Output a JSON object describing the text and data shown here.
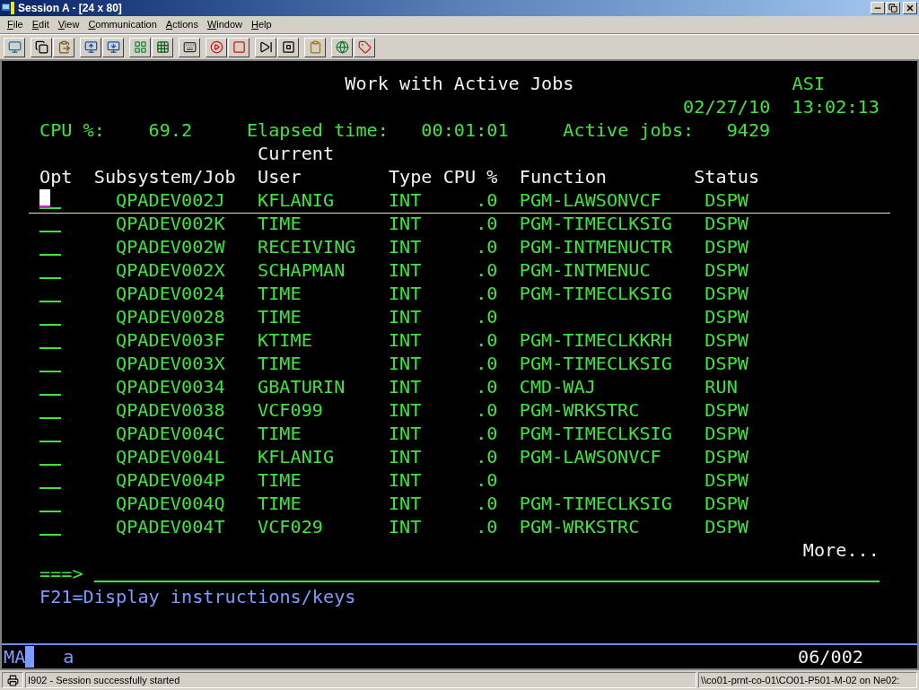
{
  "window": {
    "title": "Session A - [24 x 80]"
  },
  "menu": [
    "File",
    "Edit",
    "View",
    "Communication",
    "Actions",
    "Window",
    "Help"
  ],
  "screen": {
    "title": "Work with Active Jobs",
    "system": "ASI",
    "date": "02/27/10",
    "time": "13:02:13",
    "summary": [
      {
        "label": "CPU %:",
        "value": "69.2"
      },
      {
        "label": "Elapsed time:",
        "value": "00:01:01"
      },
      {
        "label": "Active jobs:",
        "value": "9429"
      }
    ],
    "columns": [
      {
        "label": "Opt"
      },
      {
        "label": "Subsystem/Job"
      },
      {
        "top": "Current",
        "label": "User"
      },
      {
        "label": "Type"
      },
      {
        "label": "CPU %"
      },
      {
        "label": "Function"
      },
      {
        "label": "Status"
      }
    ],
    "rows": [
      {
        "cursor": true,
        "job": "QPADEV002J",
        "user": "KFLANIG",
        "type": "INT",
        "cpu": ".0",
        "function": "PGM-LAWSONVCF",
        "status": "DSPW"
      },
      {
        "cursor": false,
        "job": "QPADEV002K",
        "user": "TIME",
        "type": "INT",
        "cpu": ".0",
        "function": "PGM-TIMECLKSIG",
        "status": "DSPW"
      },
      {
        "cursor": false,
        "job": "QPADEV002W",
        "user": "RECEIVING",
        "type": "INT",
        "cpu": ".0",
        "function": "PGM-INTMENUCTR",
        "status": "DSPW"
      },
      {
        "cursor": false,
        "job": "QPADEV002X",
        "user": "SCHAPMAN",
        "type": "INT",
        "cpu": ".0",
        "function": "PGM-INTMENUC",
        "status": "DSPW"
      },
      {
        "cursor": false,
        "job": "QPADEV0024",
        "user": "TIME",
        "type": "INT",
        "cpu": ".0",
        "function": "PGM-TIMECLKSIG",
        "status": "DSPW"
      },
      {
        "cursor": false,
        "job": "QPADEV0028",
        "user": "TIME",
        "type": "INT",
        "cpu": ".0",
        "status": "DSPW"
      },
      {
        "cursor": false,
        "job": "QPADEV003F",
        "user": "KTIME",
        "type": "INT",
        "cpu": ".0",
        "function": "PGM-TIMECLKKRH",
        "status": "DSPW"
      },
      {
        "cursor": false,
        "job": "QPADEV003X",
        "user": "TIME",
        "type": "INT",
        "cpu": ".0",
        "function": "PGM-TIMECLKSIG",
        "status": "DSPW"
      },
      {
        "cursor": false,
        "job": "QPADEV0034",
        "user": "GBATURIN",
        "type": "INT",
        "cpu": ".0",
        "function": "CMD-WAJ",
        "status": "RUN"
      },
      {
        "cursor": false,
        "job": "QPADEV0038",
        "user": "VCF099",
        "type": "INT",
        "cpu": ".0",
        "function": "PGM-WRKSTRC",
        "status": "DSPW"
      },
      {
        "cursor": false,
        "job": "QPADEV004C",
        "user": "TIME",
        "type": "INT",
        "cpu": ".0",
        "function": "PGM-TIMECLKSIG",
        "status": "DSPW"
      },
      {
        "cursor": false,
        "job": "QPADEV004L",
        "user": "KFLANIG",
        "type": "INT",
        "cpu": ".0",
        "function": "PGM-LAWSONVCF",
        "status": "DSPW"
      },
      {
        "cursor": false,
        "job": "QPADEV004P",
        "user": "TIME",
        "type": "INT",
        "cpu": ".0",
        "status": "DSPW"
      },
      {
        "cursor": false,
        "job": "QPADEV004Q",
        "user": "TIME",
        "type": "INT",
        "cpu": ".0",
        "function": "PGM-TIMECLKSIG",
        "status": "DSPW"
      },
      {
        "cursor": false,
        "job": "QPADEV004T",
        "user": "VCF029",
        "type": "INT",
        "cpu": ".0",
        "function": "PGM-WRKSTRC",
        "status": "DSPW"
      }
    ],
    "more": "More...",
    "prompt": "===>",
    "keys": "F21=Display instructions/keys"
  },
  "oia": {
    "mode": "MA",
    "shift": "a",
    "position": "06/002"
  },
  "status_bar": {
    "message": "I902 - Session successfully started",
    "printer": "\\\\co01-prnt-co-01\\CO01-P501-M-02 on Ne02:"
  }
}
